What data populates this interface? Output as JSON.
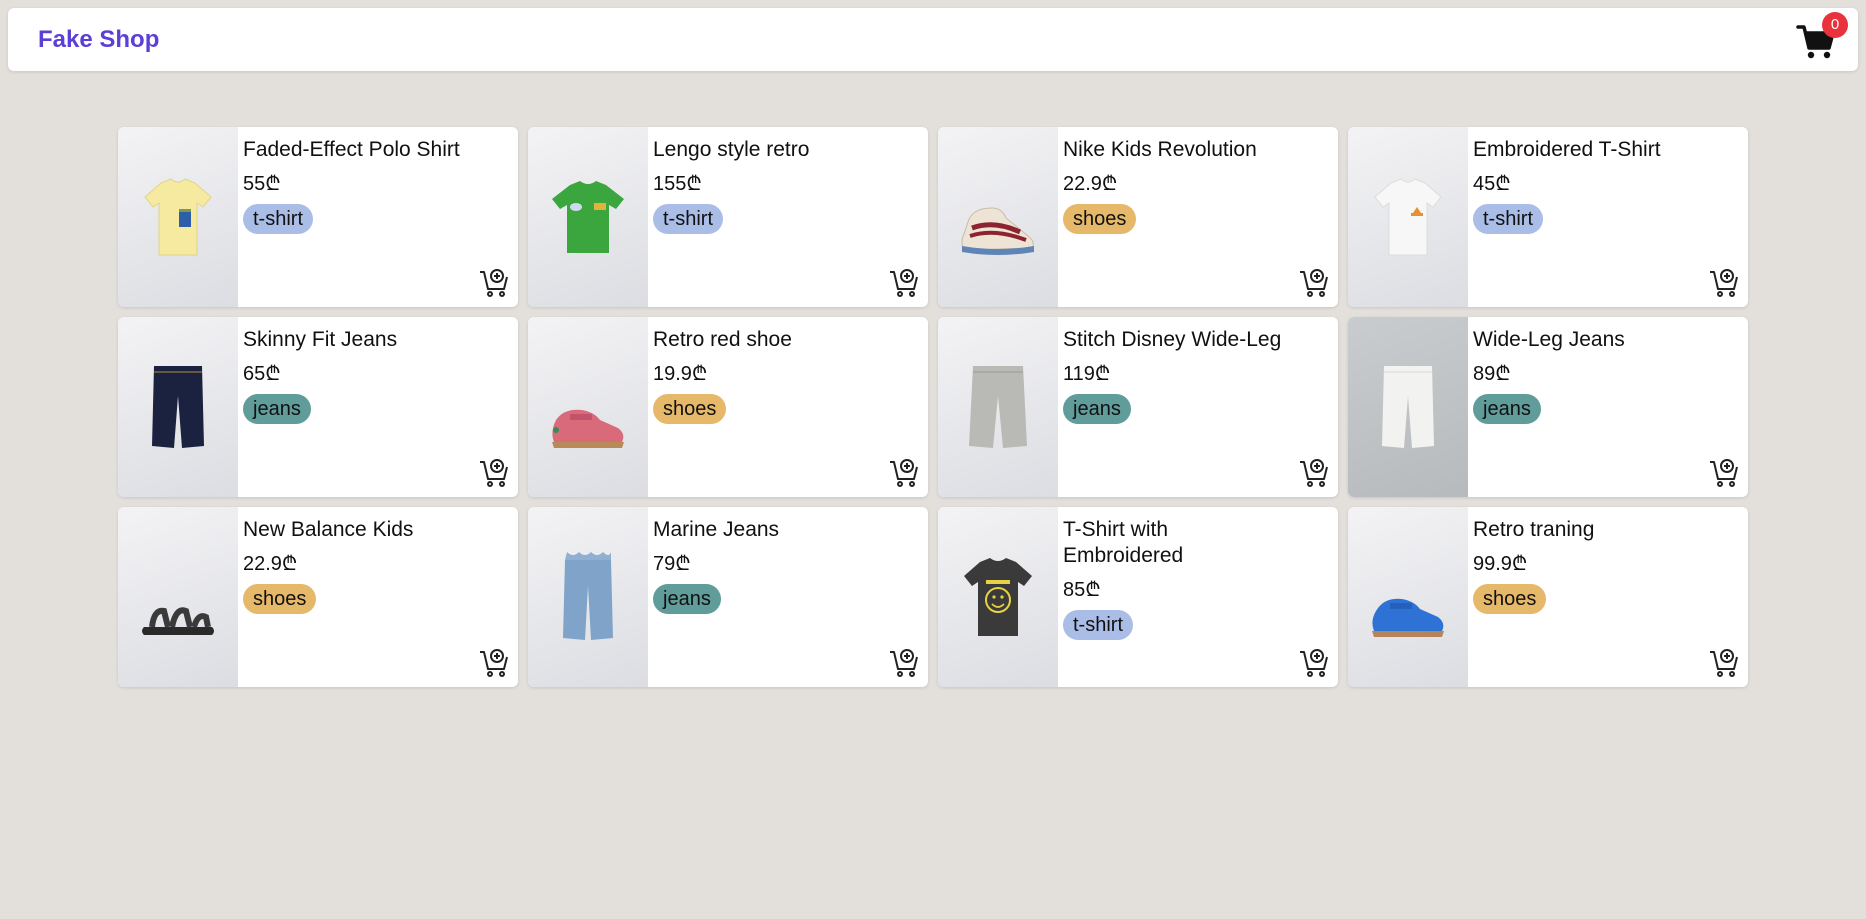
{
  "navbar": {
    "brand": "Fake Shop",
    "cart_count": "0",
    "brand_color": "#5b3fd6",
    "badge_color": "#e8323c"
  },
  "products": [
    {
      "name": "Faded-Effect Polo Shirt",
      "price": "55₾",
      "tag": "t-shirt",
      "icon": "yellow-tshirt-image"
    },
    {
      "name": "Lengo style retro",
      "price": "155₾",
      "tag": "t-shirt",
      "icon": "green-tshirt-image"
    },
    {
      "name": "Nike Kids Revolution",
      "price": "22.9₾",
      "tag": "shoes",
      "icon": "sneaker-image"
    },
    {
      "name": "Embroidered T-Shirt",
      "price": "45₾",
      "tag": "t-shirt",
      "icon": "white-tshirt-image"
    },
    {
      "name": "Skinny Fit Jeans",
      "price": "65₾",
      "tag": "jeans",
      "icon": "dark-jeans-image"
    },
    {
      "name": "Retro red shoe",
      "price": "19.9₾",
      "tag": "shoes",
      "icon": "red-shoe-image"
    },
    {
      "name": "Stitch Disney Wide-Leg",
      "price": "119₾",
      "tag": "jeans",
      "icon": "grey-jeans-image"
    },
    {
      "name": "Wide-Leg Jeans",
      "price": "89₾",
      "tag": "jeans",
      "icon": "white-jeans-image"
    },
    {
      "name": "New Balance Kids",
      "price": "22.9₾",
      "tag": "shoes",
      "icon": "sandal-image"
    },
    {
      "name": "Marine Jeans",
      "price": "79₾",
      "tag": "jeans",
      "icon": "blue-jeans-image"
    },
    {
      "name": "T-Shirt with Embroidered",
      "price": "85₾",
      "tag": "t-shirt",
      "icon": "black-tshirt-image"
    },
    {
      "name": "Retro traning",
      "price": "99.9₾",
      "tag": "shoes",
      "icon": "blue-shoe-image"
    }
  ],
  "tag_colors": {
    "t-shirt": "#aabde6",
    "shoes": "#e5b86a",
    "jeans": "#5f9c9a"
  }
}
